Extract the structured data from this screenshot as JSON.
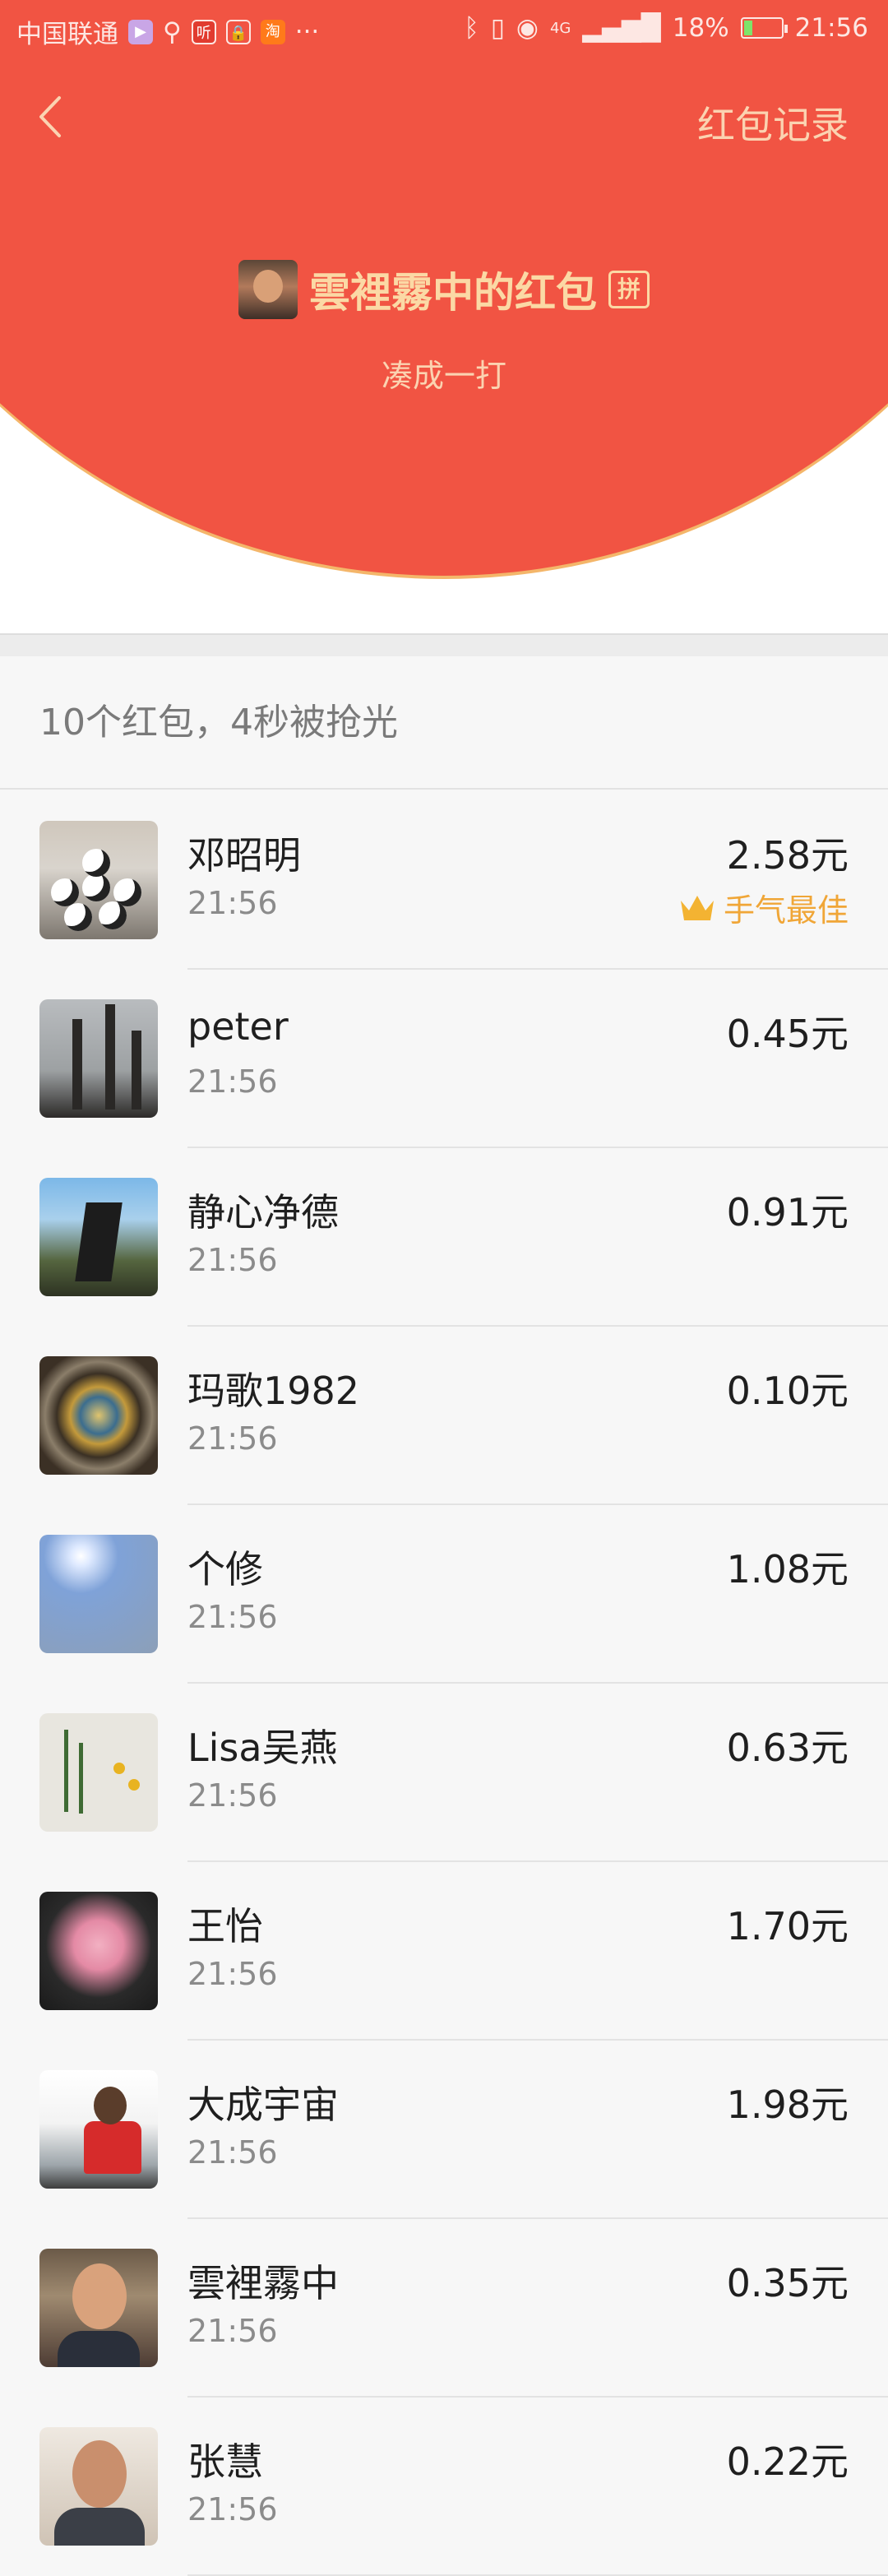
{
  "status_bar": {
    "carrier": "中国联通",
    "icons": [
      "video-app-icon",
      "usb-icon",
      "listen-app-icon",
      "lock-app-icon",
      "taobao-app-icon",
      "more-dots-icon"
    ],
    "app_glyphs": [
      "▶",
      "听",
      "🔒",
      "淘"
    ],
    "more": "···",
    "right_icons": [
      "bluetooth-icon",
      "vibrate-icon",
      "eye-icon",
      "4g-signal-icon"
    ],
    "network": "4G",
    "battery": "18%",
    "time": "21:56"
  },
  "header": {
    "back_icon": "chevron-left-icon",
    "record_link": "红包记录",
    "sender_name": "雲裡霧中的红包",
    "pin_badge": "拼",
    "wish": "凑成一打"
  },
  "summary": "10个红包，4秒被抢光",
  "colors": {
    "header_red": "#f15443",
    "gold_text": "#fbd9a5",
    "best_orange": "#f0a637"
  },
  "list": [
    {
      "name": "邓昭明",
      "time": "21:56",
      "amount": "2.58元",
      "best": "手气最佳"
    },
    {
      "name": "peter",
      "time": "21:56",
      "amount": "0.45元"
    },
    {
      "name": "静心净德",
      "time": "21:56",
      "amount": "0.91元"
    },
    {
      "name": "玛歌1982",
      "time": "21:56",
      "amount": "0.10元"
    },
    {
      "name": "个修",
      "time": "21:56",
      "amount": "1.08元"
    },
    {
      "name": "Lisa吴燕",
      "time": "21:56",
      "amount": "0.63元"
    },
    {
      "name": "王怡",
      "time": "21:56",
      "amount": "1.70元"
    },
    {
      "name": "大成宇宙",
      "time": "21:56",
      "amount": "1.98元"
    },
    {
      "name": "雲裡霧中",
      "time": "21:56",
      "amount": "0.35元"
    },
    {
      "name": "张慧",
      "time": "21:56",
      "amount": "0.22元"
    }
  ]
}
